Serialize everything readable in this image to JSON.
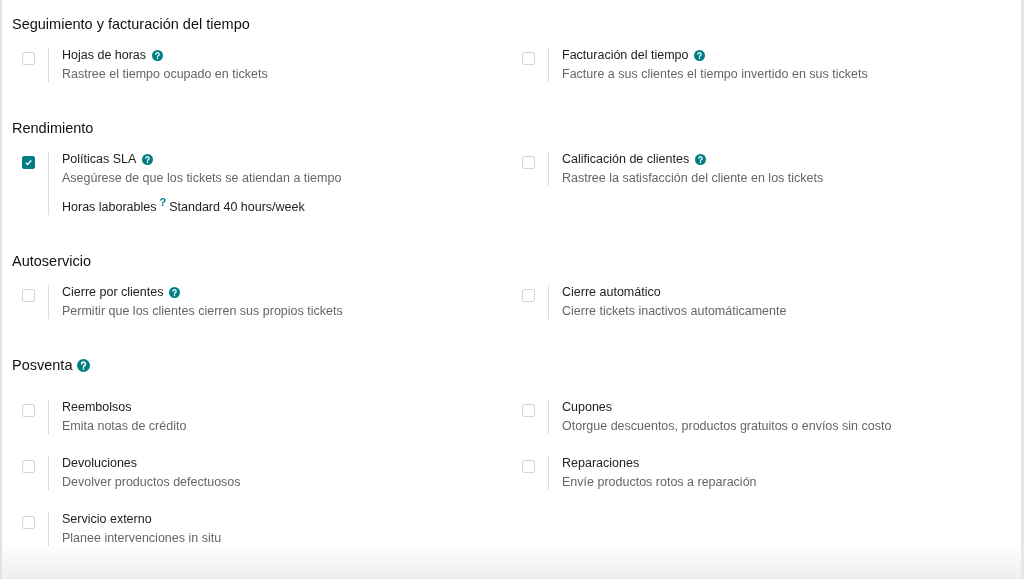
{
  "sections": [
    {
      "title": "Seguimiento y facturación del tiempo",
      "help": false,
      "settings": [
        {
          "title": "Hojas de horas",
          "help": true,
          "description": "Rastree el tiempo ocupado en tickets",
          "checked": false
        },
        {
          "title": "Facturación del tiempo",
          "help": true,
          "description": "Facture a sus clientes el tiempo invertido en sus tickets",
          "checked": false
        }
      ]
    },
    {
      "title": "Rendimiento",
      "help": false,
      "settings": [
        {
          "title": "Políticas SLA",
          "help": true,
          "description": "Asegúrese de que los tickets se atiendan a tiempo",
          "checked": true,
          "field": {
            "label": "Horas laborables",
            "help": "?",
            "value": "Standard 40 hours/week"
          }
        },
        {
          "title": "Calificación de clientes",
          "help": true,
          "description": "Rastree la satisfacción del cliente en los tickets",
          "checked": false
        }
      ]
    },
    {
      "title": "Autoservicio",
      "help": false,
      "settings": [
        {
          "title": "Cierre por clientes",
          "help": true,
          "description": "Permitir que los clientes cierren sus propios tickets",
          "checked": false
        },
        {
          "title": "Cierre automático",
          "help": false,
          "description": "Cierre tickets inactivos automáticamente",
          "checked": false
        }
      ]
    },
    {
      "title": "Posventa",
      "help": true,
      "settings": [
        {
          "title": "Reembolsos",
          "help": false,
          "description": "Emita notas de crédito",
          "checked": false
        },
        {
          "title": "Cupones",
          "help": false,
          "description": "Otorgue descuentos, productos gratuitos o envíos sin costo",
          "checked": false
        },
        {
          "title": "Devoluciones",
          "help": false,
          "description": "Devolver productos defectuosos",
          "checked": false
        },
        {
          "title": "Reparaciones",
          "help": false,
          "description": "Envíe productos rotos a reparación",
          "checked": false
        },
        {
          "title": "Servicio externo",
          "help": false,
          "description": "Planee intervenciones in situ",
          "checked": false
        }
      ]
    }
  ]
}
